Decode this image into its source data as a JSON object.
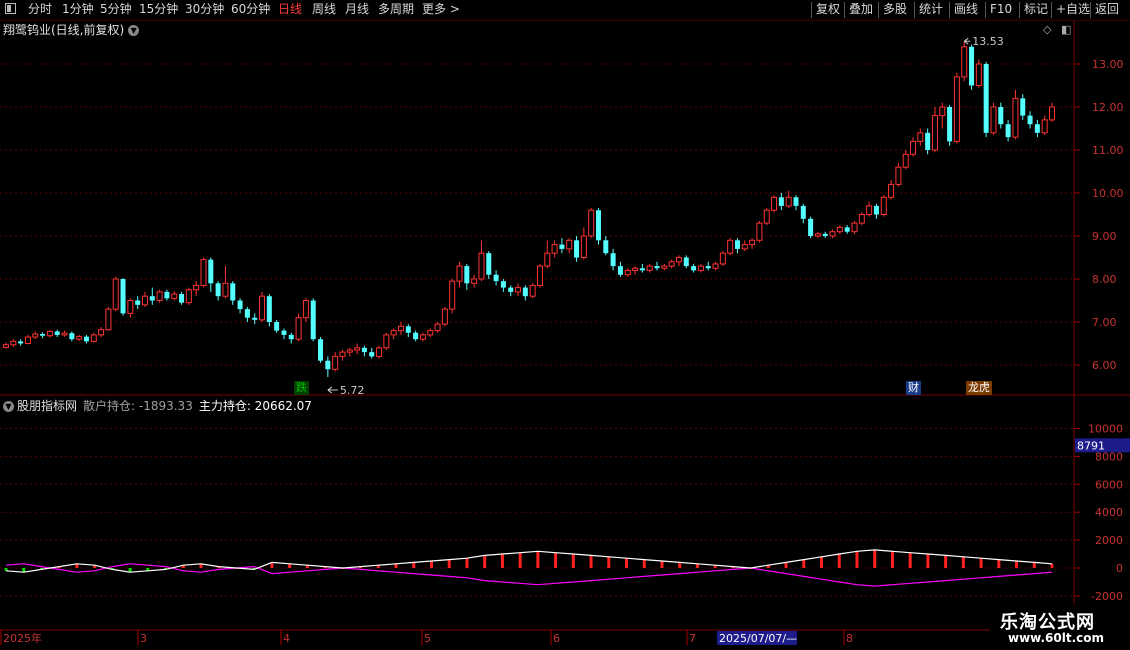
{
  "toolbar": {
    "left": [
      "分时",
      "1分钟",
      "5分钟",
      "15分钟",
      "30分钟",
      "60分钟",
      "日线",
      "周线",
      "月线",
      "多周期",
      "更多 >"
    ],
    "active": "日线",
    "right": [
      "复权",
      "叠加",
      "多股",
      "统计",
      "画线",
      "F10",
      "标记",
      "+自选",
      "返回"
    ]
  },
  "stock_title": "翔鹭钨业(日线,前复权)",
  "indicator": {
    "name": "股朋指标网",
    "label1": "散户持仓: -1893.33",
    "label2": "主力持仓: 20662.07"
  },
  "price_axis_ticks": [
    "13.00",
    "12.00",
    "11.00",
    "10.00",
    "9.00",
    "8.00",
    "7.00",
    "6.00"
  ],
  "ind_axis_ticks": [
    "10000",
    "8000",
    "6000",
    "4000",
    "2000",
    "0",
    "-2000"
  ],
  "ind_axis_highlight": "8791",
  "annotations": {
    "high": "13.53",
    "low": "5.72"
  },
  "badges": [
    {
      "text": "跌",
      "color": "#00c000",
      "bg": "#004000"
    },
    {
      "text": "财",
      "color": "#ffffff",
      "bg": "#1a3a8a"
    },
    {
      "text": "龙虎",
      "color": "#ffffff",
      "bg": "#7a3a00"
    }
  ],
  "date_labels": [
    "2025年",
    "3",
    "4",
    "5",
    "6",
    "7",
    "8"
  ],
  "crosshair_date": "2025/07/07/—",
  "watermark": {
    "title": "乐淘公式网",
    "url": "www.60lt.com"
  },
  "colors": {
    "up": "#ff3232",
    "down": "#54ffff",
    "grid": "#5a0000",
    "axis": "#7a0000",
    "retail": "#ff00ff",
    "main": "#ffffff"
  },
  "chart_data": {
    "type": "candlestick",
    "title": "翔鹭钨业(日线,前复权)",
    "candles": [
      [
        6.41,
        6.47,
        6.38,
        6.52
      ],
      [
        6.47,
        6.55,
        6.42,
        6.6
      ],
      [
        6.55,
        6.5,
        6.45,
        6.6
      ],
      [
        6.5,
        6.65,
        6.48,
        6.7
      ],
      [
        6.65,
        6.72,
        6.6,
        6.78
      ],
      [
        6.72,
        6.68,
        6.62,
        6.76
      ],
      [
        6.68,
        6.78,
        6.64,
        6.82
      ],
      [
        6.78,
        6.7,
        6.65,
        6.82
      ],
      [
        6.7,
        6.74,
        6.66,
        6.8
      ],
      [
        6.74,
        6.6,
        6.55,
        6.78
      ],
      [
        6.6,
        6.66,
        6.56,
        6.7
      ],
      [
        6.66,
        6.55,
        6.5,
        6.7
      ],
      [
        6.55,
        6.7,
        6.52,
        6.75
      ],
      [
        6.7,
        6.82,
        6.65,
        6.88
      ],
      [
        6.82,
        7.3,
        6.8,
        7.35
      ],
      [
        7.3,
        8.0,
        7.25,
        8.05
      ],
      [
        8.0,
        7.2,
        7.15,
        8.02
      ],
      [
        7.2,
        7.5,
        7.1,
        7.55
      ],
      [
        7.5,
        7.4,
        7.3,
        7.6
      ],
      [
        7.4,
        7.6,
        7.35,
        7.7
      ],
      [
        7.6,
        7.5,
        7.4,
        7.8
      ],
      [
        7.5,
        7.7,
        7.45,
        7.75
      ],
      [
        7.7,
        7.55,
        7.5,
        7.75
      ],
      [
        7.55,
        7.65,
        7.5,
        7.72
      ],
      [
        7.65,
        7.45,
        7.4,
        7.7
      ],
      [
        7.45,
        7.75,
        7.4,
        7.8
      ],
      [
        7.75,
        7.85,
        7.6,
        7.95
      ],
      [
        7.85,
        8.45,
        7.8,
        8.5
      ],
      [
        8.45,
        7.9,
        7.7,
        8.5
      ],
      [
        7.9,
        7.6,
        7.5,
        7.95
      ],
      [
        7.6,
        7.9,
        7.55,
        8.3
      ],
      [
        7.9,
        7.5,
        7.4,
        7.95
      ],
      [
        7.5,
        7.3,
        7.2,
        7.55
      ],
      [
        7.3,
        7.1,
        7.0,
        7.35
      ],
      [
        7.1,
        7.05,
        6.95,
        7.2
      ],
      [
        7.05,
        7.6,
        7.0,
        7.7
      ],
      [
        7.6,
        7.0,
        6.9,
        7.65
      ],
      [
        7.0,
        6.8,
        6.75,
        7.05
      ],
      [
        6.8,
        6.7,
        6.6,
        6.85
      ],
      [
        6.7,
        6.6,
        6.5,
        6.75
      ],
      [
        6.6,
        7.1,
        6.55,
        7.2
      ],
      [
        7.1,
        7.5,
        7.0,
        7.55
      ],
      [
        7.5,
        6.6,
        6.55,
        7.55
      ],
      [
        6.6,
        6.1,
        6.05,
        6.65
      ],
      [
        6.1,
        5.9,
        5.72,
        6.2
      ],
      [
        5.9,
        6.2,
        5.85,
        6.3
      ],
      [
        6.2,
        6.3,
        6.1,
        6.35
      ],
      [
        6.3,
        6.35,
        6.2,
        6.4
      ],
      [
        6.35,
        6.4,
        6.25,
        6.5
      ],
      [
        6.4,
        6.3,
        6.2,
        6.45
      ],
      [
        6.3,
        6.2,
        6.15,
        6.4
      ],
      [
        6.2,
        6.4,
        6.15,
        6.45
      ],
      [
        6.4,
        6.7,
        6.35,
        6.75
      ],
      [
        6.7,
        6.8,
        6.6,
        6.85
      ],
      [
        6.8,
        6.9,
        6.7,
        7.0
      ],
      [
        6.9,
        6.75,
        6.65,
        6.95
      ],
      [
        6.75,
        6.6,
        6.55,
        6.8
      ],
      [
        6.6,
        6.7,
        6.55,
        6.75
      ],
      [
        6.7,
        6.8,
        6.65,
        6.85
      ],
      [
        6.8,
        6.95,
        6.75,
        7.0
      ],
      [
        6.95,
        7.3,
        6.9,
        7.35
      ],
      [
        7.3,
        7.95,
        7.2,
        8.0
      ],
      [
        7.95,
        8.3,
        7.8,
        8.4
      ],
      [
        8.3,
        7.9,
        7.75,
        8.35
      ],
      [
        7.9,
        8.0,
        7.8,
        8.1
      ],
      [
        8.0,
        8.6,
        7.95,
        8.9
      ],
      [
        8.6,
        8.1,
        8.0,
        8.65
      ],
      [
        8.1,
        7.95,
        7.85,
        8.2
      ],
      [
        7.95,
        7.8,
        7.7,
        8.0
      ],
      [
        7.8,
        7.7,
        7.6,
        7.85
      ],
      [
        7.7,
        7.8,
        7.6,
        7.9
      ],
      [
        7.8,
        7.6,
        7.5,
        7.85
      ],
      [
        7.6,
        7.85,
        7.55,
        7.9
      ],
      [
        7.85,
        8.3,
        7.8,
        8.35
      ],
      [
        8.3,
        8.6,
        8.25,
        8.9
      ],
      [
        8.6,
        8.8,
        8.5,
        8.9
      ],
      [
        8.8,
        8.7,
        8.6,
        8.95
      ],
      [
        8.7,
        8.9,
        8.6,
        8.95
      ],
      [
        8.9,
        8.5,
        8.4,
        9.0
      ],
      [
        8.5,
        9.0,
        8.45,
        9.2
      ],
      [
        9.0,
        9.6,
        8.95,
        9.65
      ],
      [
        9.6,
        8.9,
        8.8,
        9.65
      ],
      [
        8.9,
        8.6,
        8.55,
        9.0
      ],
      [
        8.6,
        8.3,
        8.2,
        8.7
      ],
      [
        8.3,
        8.1,
        8.05,
        8.4
      ],
      [
        8.1,
        8.2,
        8.05,
        8.25
      ],
      [
        8.2,
        8.25,
        8.1,
        8.3
      ],
      [
        8.25,
        8.2,
        8.15,
        8.35
      ],
      [
        8.2,
        8.3,
        8.15,
        8.35
      ],
      [
        8.3,
        8.25,
        8.2,
        8.4
      ],
      [
        8.25,
        8.3,
        8.2,
        8.35
      ],
      [
        8.3,
        8.4,
        8.25,
        8.45
      ],
      [
        8.4,
        8.5,
        8.3,
        8.55
      ],
      [
        8.5,
        8.3,
        8.25,
        8.55
      ],
      [
        8.3,
        8.2,
        8.15,
        8.35
      ],
      [
        8.2,
        8.3,
        8.15,
        8.35
      ],
      [
        8.3,
        8.25,
        8.2,
        8.4
      ],
      [
        8.25,
        8.35,
        8.2,
        8.4
      ],
      [
        8.35,
        8.6,
        8.3,
        8.65
      ],
      [
        8.6,
        8.9,
        8.55,
        8.95
      ],
      [
        8.9,
        8.7,
        8.6,
        8.95
      ],
      [
        8.7,
        8.8,
        8.65,
        8.9
      ],
      [
        8.8,
        8.9,
        8.7,
        8.95
      ],
      [
        8.9,
        9.3,
        8.85,
        9.35
      ],
      [
        9.3,
        9.6,
        9.25,
        9.65
      ],
      [
        9.6,
        9.9,
        9.55,
        9.95
      ],
      [
        9.9,
        9.7,
        9.6,
        10.0
      ],
      [
        9.7,
        9.9,
        9.65,
        10.05
      ],
      [
        9.9,
        9.7,
        9.6,
        9.95
      ],
      [
        9.7,
        9.4,
        9.3,
        9.75
      ],
      [
        9.4,
        9.0,
        8.95,
        9.45
      ],
      [
        9.0,
        9.05,
        8.95,
        9.1
      ],
      [
        9.05,
        9.0,
        8.95,
        9.1
      ],
      [
        9.0,
        9.1,
        8.95,
        9.15
      ],
      [
        9.1,
        9.2,
        9.05,
        9.25
      ],
      [
        9.2,
        9.1,
        9.05,
        9.25
      ],
      [
        9.1,
        9.3,
        9.05,
        9.35
      ],
      [
        9.3,
        9.5,
        9.25,
        9.55
      ],
      [
        9.5,
        9.7,
        9.45,
        9.8
      ],
      [
        9.7,
        9.5,
        9.4,
        9.75
      ],
      [
        9.5,
        9.9,
        9.45,
        9.95
      ],
      [
        9.9,
        10.2,
        9.85,
        10.3
      ],
      [
        10.2,
        10.6,
        10.15,
        10.7
      ],
      [
        10.6,
        10.9,
        10.55,
        11.0
      ],
      [
        10.9,
        11.2,
        10.85,
        11.3
      ],
      [
        11.2,
        11.4,
        11.1,
        11.5
      ],
      [
        11.4,
        11.0,
        10.9,
        11.5
      ],
      [
        11.0,
        11.8,
        10.95,
        12.0
      ],
      [
        11.8,
        12.0,
        11.5,
        12.1
      ],
      [
        12.0,
        11.2,
        11.1,
        12.05
      ],
      [
        11.2,
        12.7,
        11.15,
        12.8
      ],
      [
        12.7,
        13.4,
        12.6,
        13.53
      ],
      [
        13.4,
        12.5,
        12.4,
        13.45
      ],
      [
        12.5,
        13.0,
        12.45,
        13.1
      ],
      [
        13.0,
        11.4,
        11.3,
        13.05
      ],
      [
        11.4,
        12.0,
        11.35,
        12.1
      ],
      [
        12.0,
        11.6,
        11.5,
        12.1
      ],
      [
        11.6,
        11.3,
        11.2,
        11.7
      ],
      [
        11.3,
        12.2,
        11.25,
        12.4
      ],
      [
        12.2,
        11.8,
        11.7,
        12.3
      ],
      [
        11.8,
        11.6,
        11.5,
        11.9
      ],
      [
        11.6,
        11.4,
        11.3,
        11.7
      ],
      [
        11.4,
        11.7,
        11.35,
        11.8
      ],
      [
        11.7,
        12.0,
        11.65,
        12.1
      ]
    ],
    "indicator_series": [
      {
        "name": "散户持仓",
        "values": [
          200,
          300,
          100,
          -100,
          -300,
          -200,
          100,
          300,
          200,
          100,
          -200,
          -300,
          -100,
          0,
          100,
          -400,
          -300,
          -200,
          -100,
          0,
          -100,
          -200,
          -300,
          -400,
          -500,
          -600,
          -700,
          -900,
          -1000,
          -1100,
          -1200,
          -1100,
          -1000,
          -900,
          -800,
          -700,
          -600,
          -500,
          -400,
          -300,
          -200,
          -100,
          0,
          -200,
          -400,
          -600,
          -800,
          -1000,
          -1200,
          -1300,
          -1200,
          -1100,
          -1000,
          -900,
          -800,
          -700,
          -600,
          -500,
          -400,
          -300
        ]
      },
      {
        "name": "主力持仓",
        "values": [
          -200,
          -300,
          -100,
          100,
          300,
          200,
          -100,
          -300,
          -200,
          -100,
          200,
          300,
          100,
          0,
          -100,
          400,
          300,
          200,
          100,
          0,
          100,
          200,
          300,
          400,
          500,
          600,
          700,
          900,
          1000,
          1100,
          1200,
          1100,
          1000,
          900,
          800,
          700,
          600,
          500,
          400,
          300,
          200,
          100,
          0,
          200,
          400,
          600,
          800,
          1000,
          1200,
          1300,
          1200,
          1100,
          1000,
          900,
          800,
          700,
          600,
          500,
          400,
          300
        ]
      }
    ]
  }
}
